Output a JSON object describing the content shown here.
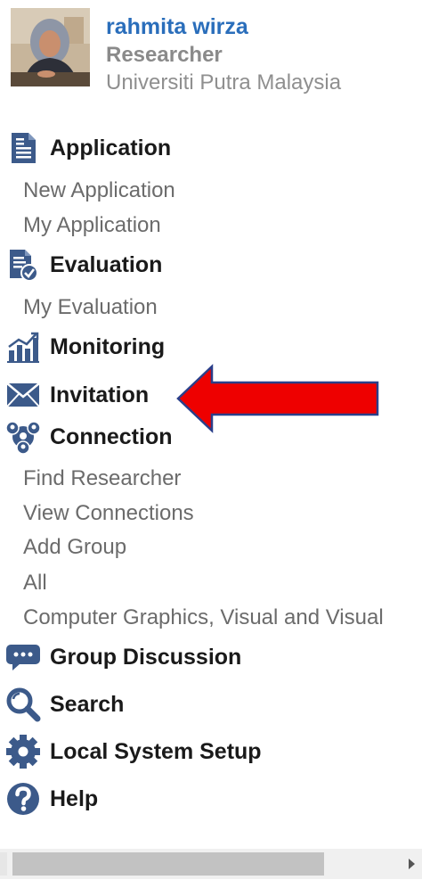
{
  "profile": {
    "name": "rahmita wirza",
    "role": "Researcher",
    "organization": "Universiti Putra Malaysia"
  },
  "menu": {
    "application": {
      "label": "Application",
      "items": [
        "New Application",
        "My Application"
      ]
    },
    "evaluation": {
      "label": "Evaluation",
      "items": [
        "My Evaluation"
      ]
    },
    "monitoring": {
      "label": "Monitoring"
    },
    "invitation": {
      "label": "Invitation"
    },
    "connection": {
      "label": "Connection",
      "items": [
        "Find Researcher",
        "View Connections",
        "Add Group",
        "All",
        "Computer Graphics, Visual and Visual"
      ]
    },
    "group_discussion": {
      "label": "Group Discussion"
    },
    "search": {
      "label": "Search"
    },
    "local_system_setup": {
      "label": "Local System Setup"
    },
    "help": {
      "label": "Help"
    }
  },
  "colors": {
    "accent_blue": "#2a6ebb",
    "icon_blue": "#3c5a8a",
    "arrow_red": "#ee0000",
    "arrow_outline": "#2a3f8a"
  },
  "icons": {
    "application": "document-icon",
    "evaluation": "document-check-icon",
    "monitoring": "bar-chart-icon",
    "invitation": "envelope-icon",
    "connection": "network-icon",
    "group_discussion": "chat-icon",
    "search": "magnifier-icon",
    "local_system_setup": "gear-icon",
    "help": "help-icon"
  }
}
